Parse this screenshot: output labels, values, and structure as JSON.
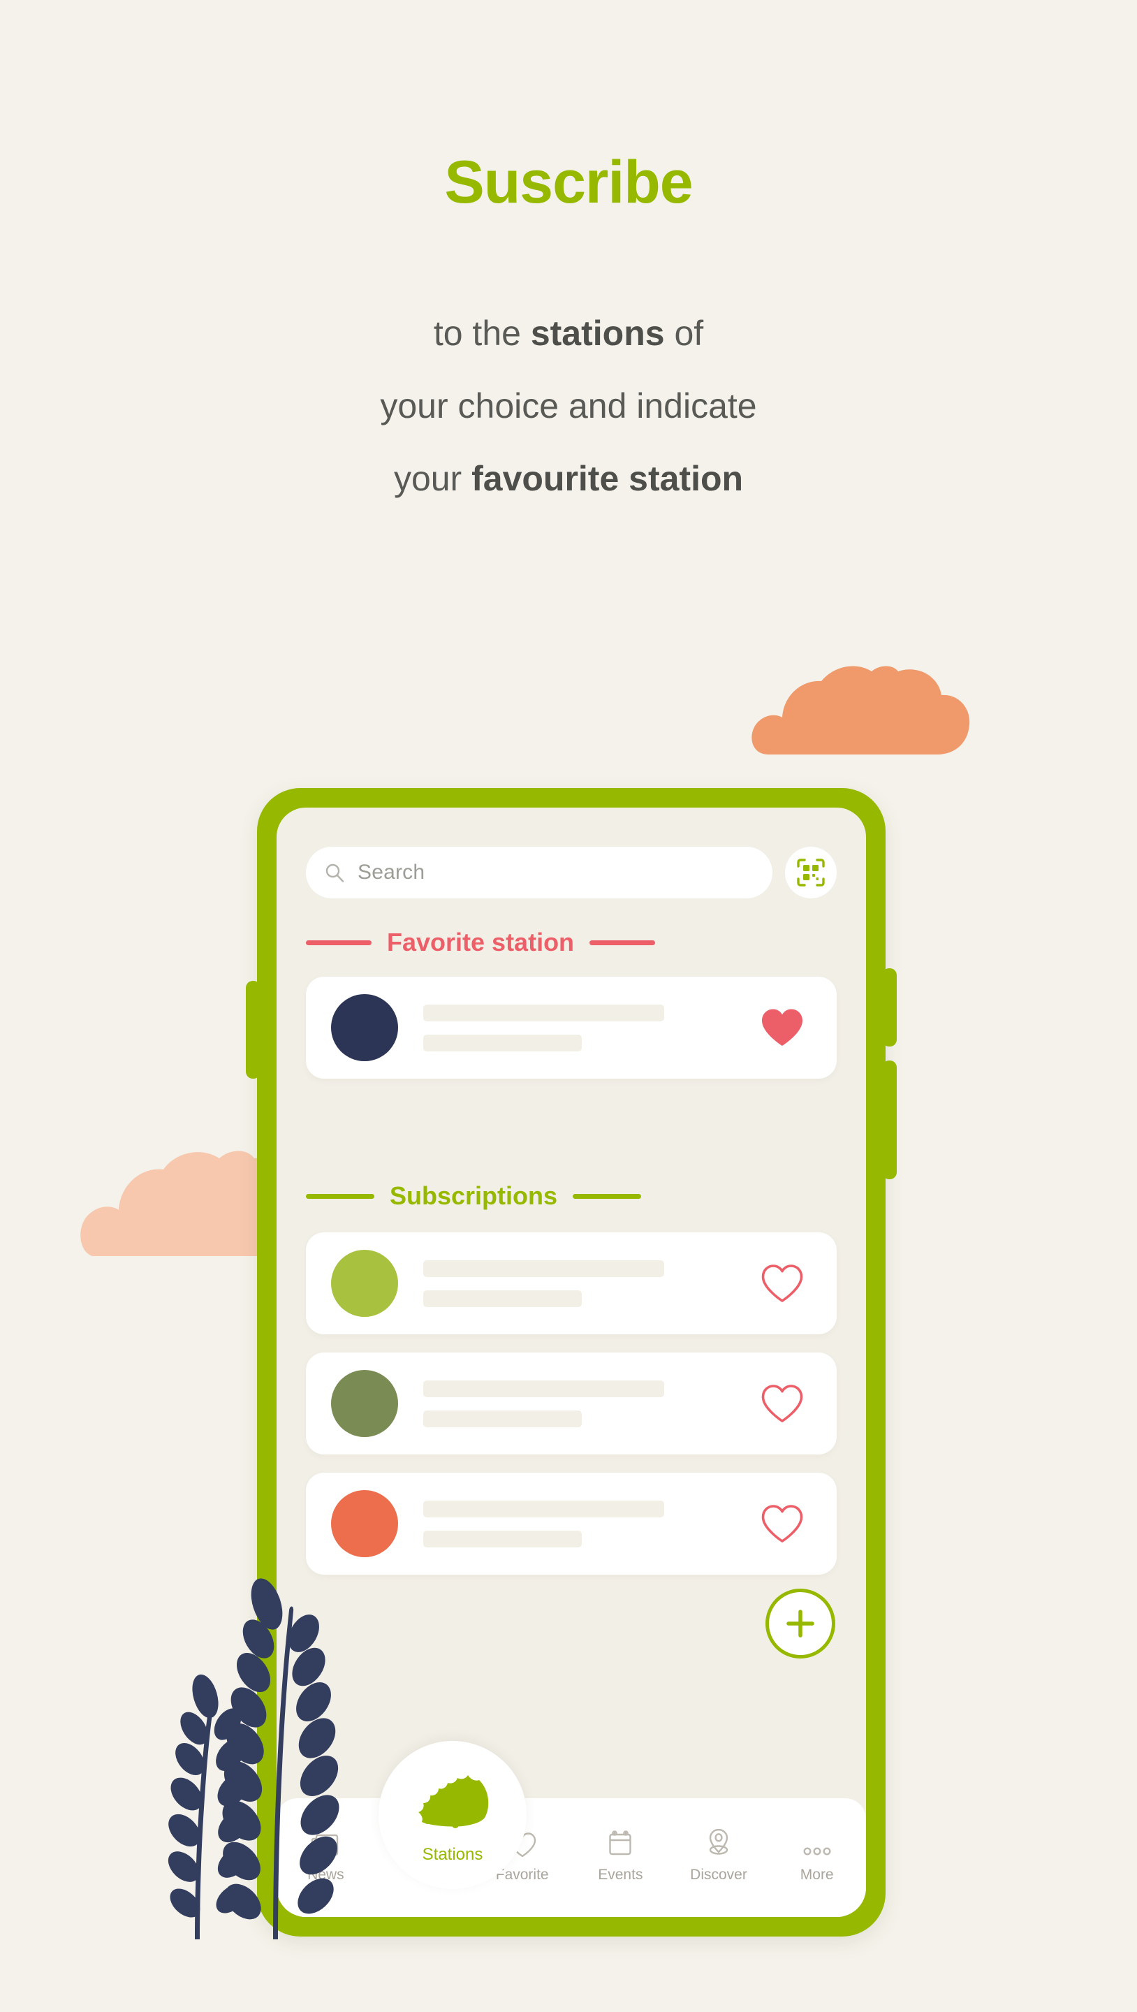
{
  "page": {
    "background_color": "#f4f2ea",
    "headline": "Suscribe",
    "headline_color": "#96b900",
    "subtitle_lines": [
      {
        "pre": "to the ",
        "bold": "stations",
        "post": " of"
      },
      {
        "pre": "your choice and indicate",
        "bold": "",
        "post": ""
      },
      {
        "pre": "your ",
        "bold": "favourite station",
        "post": ""
      }
    ],
    "subtitle_color": "#595a55"
  },
  "decorations": {
    "cloud_orange_color": "#f0996a",
    "cloud_pink_color": "#f7c8ae",
    "plant_color": "#333d5e"
  },
  "phone": {
    "frame_color": "#96b900",
    "screen_color": "#f2efe7",
    "buttons": [
      "volume-button",
      "power-button",
      "power-button-lower"
    ]
  },
  "search": {
    "placeholder": "Search",
    "icon": "search-icon",
    "scan_icon": "qr-scan-icon",
    "scan_icon_color": "#96b900"
  },
  "sections": [
    {
      "id": "favorite",
      "label": "Favorite station",
      "color": "#ec5f69"
    },
    {
      "id": "subscriptions",
      "label": "Subscriptions",
      "color": "#96b900"
    }
  ],
  "favorite_station": {
    "avatar_color": "#2c3555",
    "heart_icon": "heart-filled-icon",
    "heart_color": "#ec5f69",
    "favorited": true
  },
  "subscriptions": [
    {
      "avatar_color": "#a8c23f",
      "heart_icon": "heart-outline-icon",
      "heart_color": "#ec5f69",
      "favorited": false
    },
    {
      "avatar_color": "#7a8b54",
      "heart_icon": "heart-outline-icon",
      "heart_color": "#ec5f69",
      "favorited": false
    },
    {
      "avatar_color": "#ec6e4c",
      "heart_icon": "heart-outline-icon",
      "heart_color": "#ec5f69",
      "favorited": false
    }
  ],
  "fab": {
    "icon": "plus-icon",
    "color": "#96b900"
  },
  "bottom_nav": {
    "items": [
      {
        "label": "News",
        "icon": "news-icon",
        "active": false
      },
      {
        "label": "Stations",
        "icon": "hedgehog-icon",
        "active": true
      },
      {
        "label": "Favorite",
        "icon": "heart-outline-icon",
        "active": false
      },
      {
        "label": "Events",
        "icon": "calendar-icon",
        "active": false
      },
      {
        "label": "Discover",
        "icon": "map-pin-icon",
        "active": false
      },
      {
        "label": "More",
        "icon": "ellipsis-icon",
        "active": false
      }
    ],
    "active_color": "#96b900",
    "inactive_color": "#a9a59c"
  }
}
